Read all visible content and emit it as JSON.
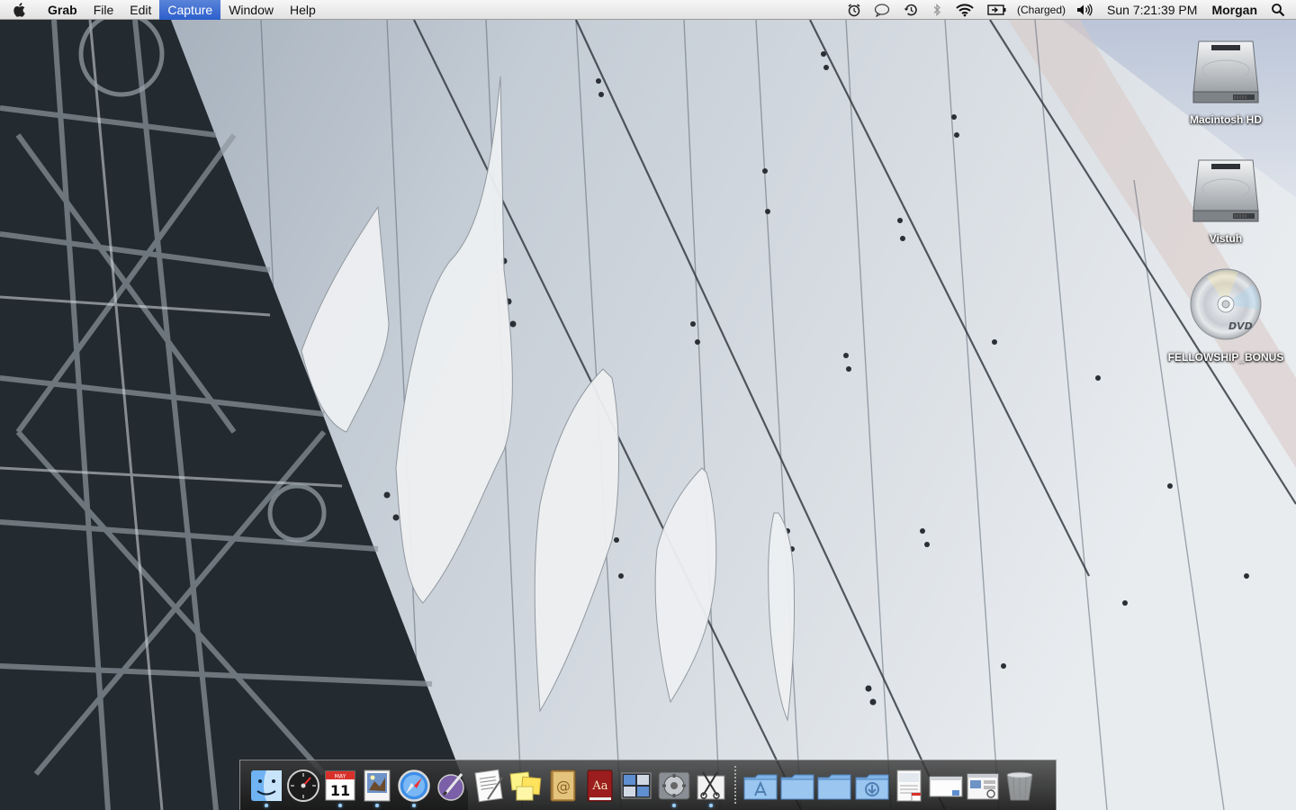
{
  "menubar": {
    "app_name": "Grab",
    "menus": [
      "File",
      "Edit",
      "Capture",
      "Window",
      "Help"
    ],
    "active_menu": "Capture",
    "status": {
      "battery_text": "(Charged)",
      "clock": "Sun 7:21:39 PM",
      "user": "Morgan"
    },
    "icons": [
      "apple-icon",
      "alarm-clock-icon",
      "chat-bubble-icon",
      "time-machine-icon",
      "bluetooth-icon",
      "wifi-icon",
      "battery-icon",
      "volume-icon",
      "spotlight-icon"
    ]
  },
  "desktop": {
    "icons": [
      {
        "label": "Macintosh HD",
        "type": "hard-drive-icon"
      },
      {
        "label": "Vistuh",
        "type": "hard-drive-icon"
      },
      {
        "label": "FELLOWSHIP_BONUS",
        "type": "dvd-icon"
      }
    ]
  },
  "dock": {
    "apps": [
      {
        "name": "Finder",
        "icon": "finder-icon",
        "running": true
      },
      {
        "name": "Dashboard",
        "icon": "dashboard-icon",
        "running": false
      },
      {
        "name": "iCal",
        "icon": "ical-icon",
        "running": true,
        "month": "MAY",
        "day": "11"
      },
      {
        "name": "Preview",
        "icon": "preview-icon",
        "running": true
      },
      {
        "name": "Safari",
        "icon": "safari-icon",
        "running": true
      },
      {
        "name": "Script Editor",
        "icon": "script-editor-icon",
        "running": false
      },
      {
        "name": "TextEdit",
        "icon": "textedit-icon",
        "running": false
      },
      {
        "name": "Stickies",
        "icon": "stickies-icon",
        "running": false
      },
      {
        "name": "Address Book",
        "icon": "address-book-icon",
        "running": false
      },
      {
        "name": "Dictionary",
        "icon": "dictionary-icon",
        "running": false
      },
      {
        "name": "Spaces",
        "icon": "spaces-icon",
        "running": false
      },
      {
        "name": "System Preferences",
        "icon": "system-preferences-icon",
        "running": true
      },
      {
        "name": "Grab",
        "icon": "grab-icon",
        "running": true
      }
    ],
    "stacks": [
      {
        "name": "Applications",
        "icon": "applications-folder-icon"
      },
      {
        "name": "Documents",
        "icon": "folder-icon"
      },
      {
        "name": "Folder",
        "icon": "folder-icon"
      },
      {
        "name": "Downloads",
        "icon": "downloads-folder-icon"
      },
      {
        "name": "Document 1",
        "icon": "document-thumbnail-icon"
      },
      {
        "name": "Document 2",
        "icon": "window-thumbnail-icon"
      },
      {
        "name": "Document 3",
        "icon": "screenshot-thumbnail-icon"
      },
      {
        "name": "Trash",
        "icon": "trash-icon"
      }
    ]
  }
}
